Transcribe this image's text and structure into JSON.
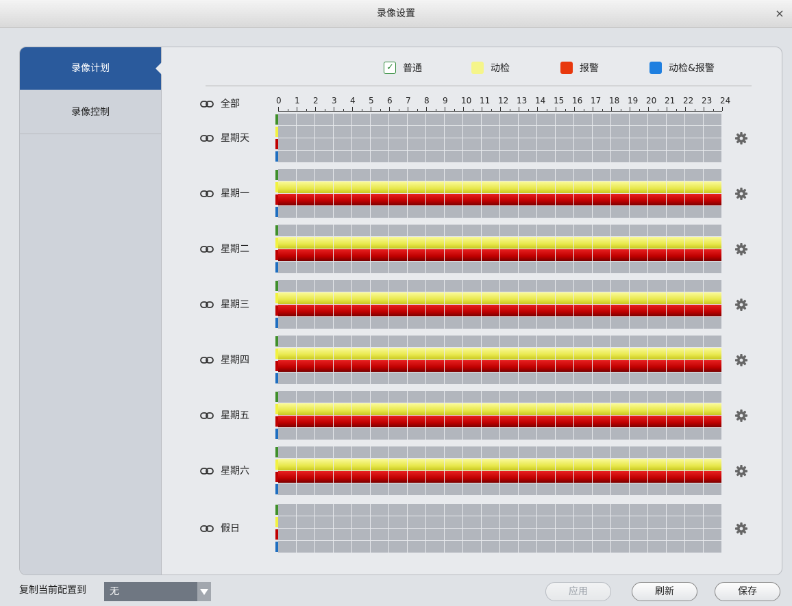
{
  "window": {
    "title": "录像设置",
    "close_glyph": "×"
  },
  "sidebar": {
    "items": [
      {
        "label": "录像计划",
        "active": true
      },
      {
        "label": "录像控制",
        "active": false
      }
    ]
  },
  "legend": [
    {
      "label": "普通",
      "color": "#ffffff",
      "checked": true,
      "check_glyph": "✓"
    },
    {
      "label": "动检",
      "color": "#f5f58a"
    },
    {
      "label": "报警",
      "color": "#e8380d"
    },
    {
      "label": "动检&报警",
      "color": "#1e7fe0"
    }
  ],
  "schedule": {
    "all_label": "全部",
    "hours": [
      "0",
      "1",
      "2",
      "3",
      "4",
      "5",
      "6",
      "7",
      "8",
      "9",
      "10",
      "11",
      "12",
      "13",
      "14",
      "15",
      "16",
      "17",
      "18",
      "19",
      "20",
      "21",
      "22",
      "23",
      "24"
    ],
    "lane_colors": {
      "normal": "#3f8f2a",
      "motion": "#f2f240",
      "alarm": "#c00000",
      "motion_alarm": "#1e6ec0"
    },
    "days": [
      {
        "label": "星期天",
        "motion": false,
        "alarm": false
      },
      {
        "label": "星期一",
        "motion": true,
        "alarm": true
      },
      {
        "label": "星期二",
        "motion": true,
        "alarm": true
      },
      {
        "label": "星期三",
        "motion": true,
        "alarm": true
      },
      {
        "label": "星期四",
        "motion": true,
        "alarm": true
      },
      {
        "label": "星期五",
        "motion": true,
        "alarm": true
      },
      {
        "label": "星期六",
        "motion": true,
        "alarm": true
      },
      {
        "label": "假日",
        "motion": false,
        "alarm": false
      }
    ],
    "icons": {
      "row_link": "link-icon",
      "row_settings": "gear-icon"
    }
  },
  "footer": {
    "copy_label": "复制当前配置到",
    "copy_target": "无",
    "buttons": {
      "apply": "应用",
      "refresh": "刷新",
      "save": "保存"
    },
    "apply_disabled": true
  },
  "colors": {
    "accent": "#2a5a9c",
    "sidebar_bg": "#cfd3da",
    "grid_bg": "#b2b6bd"
  }
}
